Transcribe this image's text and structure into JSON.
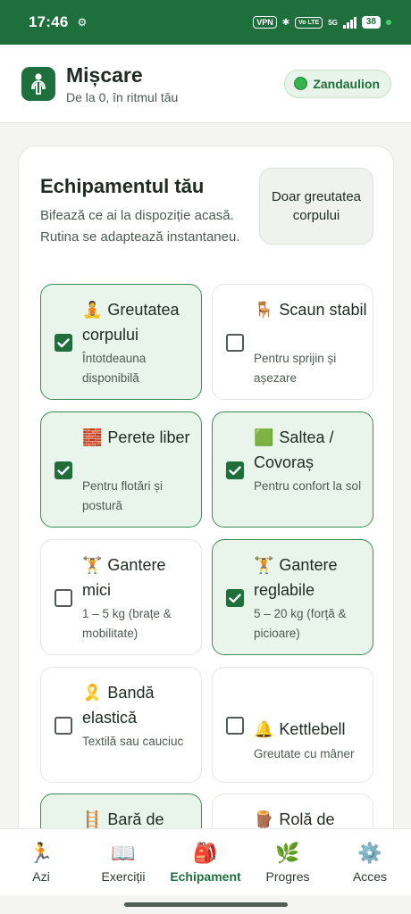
{
  "status_bar": {
    "time": "17:46",
    "vpn": "VPN",
    "volte": "Vo LTE",
    "network": "5G",
    "battery": "38"
  },
  "header": {
    "title": "Mișcare",
    "subtitle": "De la 0, în ritmul tău",
    "user": "Zandaulion"
  },
  "equipment": {
    "title": "Echipamentul tău",
    "description": "Bifează ce ai la dispoziție acasă. Rutina se adaptează instantaneu.",
    "bodyweight_button": "Doar greutatea corpului",
    "items": [
      {
        "emoji": "🧘",
        "title": "Greutatea corpului",
        "subtitle": "Întotdeauna disponibilă",
        "checked": true
      },
      {
        "emoji": "🪑",
        "title": "Scaun stabil",
        "subtitle": "Pentru sprijin și așezare",
        "checked": false
      },
      {
        "emoji": "🧱",
        "title": "Perete liber",
        "subtitle": "Pentru flotări și postură",
        "checked": true
      },
      {
        "emoji": "🟩",
        "title": "Saltea / Covoraș",
        "subtitle": "Pentru confort la sol",
        "checked": true
      },
      {
        "emoji": "🏋️",
        "title": "Gantere mici",
        "subtitle": "1 – 5 kg (brațe & mobilitate)",
        "checked": false
      },
      {
        "emoji": "🏋️",
        "title": "Gantere reglabile",
        "subtitle": "5 – 20 kg (forță & picioare)",
        "checked": true
      },
      {
        "emoji": "🎗️",
        "title": "Bandă elastică",
        "subtitle": "Textilă sau cauciuc",
        "checked": false
      },
      {
        "emoji": "🔔",
        "title": "Kettlebell",
        "subtitle": "Greutate cu mâner",
        "checked": false
      },
      {
        "emoji": "🪜",
        "title": "Bară de",
        "subtitle": "",
        "checked": true
      },
      {
        "emoji": "🪵",
        "title": "Rolă de",
        "subtitle": "",
        "checked": false
      }
    ]
  },
  "nav": {
    "items": [
      {
        "emoji": "🏃",
        "label": "Azi",
        "active": false
      },
      {
        "emoji": "📖",
        "label": "Exerciții",
        "active": false
      },
      {
        "emoji": "🎒",
        "label": "Echipament",
        "active": true
      },
      {
        "emoji": "🌿",
        "label": "Progres",
        "active": false
      },
      {
        "emoji": "⚙️",
        "label": "Acces",
        "active": false
      }
    ]
  },
  "colors": {
    "brand": "#1f6f3d",
    "checked_bg": "#e9f5eb",
    "checked_border": "#3f8c57"
  }
}
